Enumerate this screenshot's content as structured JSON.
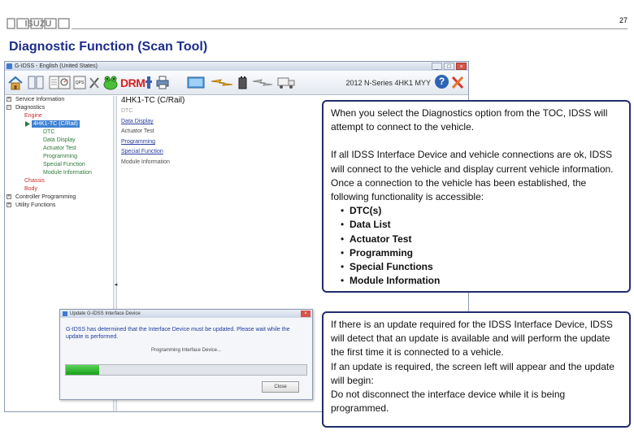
{
  "slide": {
    "brand": "ISUZU",
    "page_number": "27",
    "title": "Diagnostic Function (Scan Tool)"
  },
  "app_window": {
    "title": "G-IDSS - English (United States)",
    "controls": [
      "_",
      "□",
      "×"
    ],
    "toolbar": {
      "drm_label": "DRM",
      "vehicle": "2012 N-Series 4HK1 MYY",
      "help_label": "?",
      "icons": [
        "home-icon",
        "book-icon",
        "document-stack-icon",
        "diagnostics-icon",
        "qps-icon",
        "tools-icon",
        "frog-icon",
        "drm-icon",
        "connector-icon",
        "printer-icon",
        "screen-icon",
        "lightning-icon",
        "battery-icon",
        "lightning-disabled-icon",
        "truck-icon",
        "help-icon",
        "settings-tool-icon"
      ]
    },
    "toc": {
      "items": [
        {
          "label": "Service Information",
          "level": 0
        },
        {
          "label": "Diagnostics",
          "level": 0
        },
        {
          "label": "Engine",
          "level": 1
        },
        {
          "label": "4HK1-TC (C/Rail)",
          "level": 2,
          "selected": true
        },
        {
          "label": "DTC",
          "level": 2
        },
        {
          "label": "Data Display",
          "level": 2
        },
        {
          "label": "Actuator Test",
          "level": 2
        },
        {
          "label": "Programming",
          "level": 2
        },
        {
          "label": "Special Function",
          "level": 2
        },
        {
          "label": "Module Information",
          "level": 2
        },
        {
          "label": "Chassis",
          "level": 1
        },
        {
          "label": "Body",
          "level": 1
        },
        {
          "label": "Controller Programming",
          "level": 0
        },
        {
          "label": "Utility Functions",
          "level": 0
        }
      ]
    },
    "content": {
      "title": "4HK1-TC (C/Rail)",
      "links": [
        {
          "label": "DTC",
          "style": "gray"
        },
        {
          "label": "Data Display",
          "style": "link"
        },
        {
          "label": "Actuator Test",
          "style": "plain"
        },
        {
          "label": "Programming",
          "style": "link"
        },
        {
          "label": "Special Function",
          "style": "link"
        },
        {
          "label": "Module Information",
          "style": "plain"
        }
      ]
    }
  },
  "update_dialog": {
    "title": "Update G-IDSS Interface Device",
    "message": "G-IDSS has determined that the Interface Device must be updated. Please wait while the update is performed.",
    "status": "Programming Interface Device...",
    "progress": 0.14,
    "close_label": "Close"
  },
  "callouts": {
    "connect": {
      "intro": "When you select the Diagnostics option from the TOC, IDSS will attempt to connect to the vehicle.",
      "detail": "If all IDSS Interface Device and vehicle connections are ok, IDSS will connect to the vehicle and display current vehicle information. Once a connection to the vehicle has been established, the following functionality is accessible:",
      "bullets": [
        "DTC(s)",
        "Data List",
        "Actuator Test",
        "Programming",
        "Special Functions",
        "Module Information"
      ]
    },
    "update": {
      "line1": "If there is an update required for the IDSS Interface Device, IDSS will detect that an update is available and will perform the update the first time it is connected to a vehicle.",
      "line2": "If an update is required, the screen left will appear and the update will begin:",
      "line3": "Do not disconnect the interface device while it is being programmed."
    }
  },
  "colors": {
    "title_blue": "#1c2d8a",
    "callout_border": "#222d6e",
    "progress_green": "#18a018",
    "drm_red": "#d42020",
    "toc_red": "#c62b2b",
    "toc_green": "#2f7a3a"
  }
}
